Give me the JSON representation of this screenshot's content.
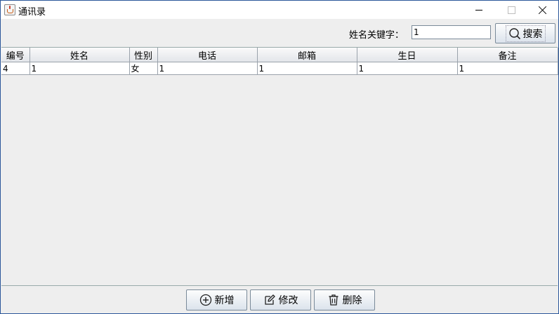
{
  "window": {
    "title": "通讯录"
  },
  "search": {
    "label": "姓名关键字：",
    "value": "1",
    "button_label": "搜索"
  },
  "table": {
    "columns": [
      "编号",
      "姓名",
      "性别",
      "电话",
      "邮箱",
      "生日",
      "备注"
    ],
    "rows": [
      [
        "4",
        "1",
        "女",
        "1",
        "1",
        "1",
        "1"
      ]
    ]
  },
  "actions": {
    "add_label": "新增",
    "edit_label": "修改",
    "delete_label": "删除"
  },
  "colors": {
    "window_border": "#2b579a",
    "background": "#eeeeee",
    "button_gradient_bottom": "#dbe3ec"
  }
}
